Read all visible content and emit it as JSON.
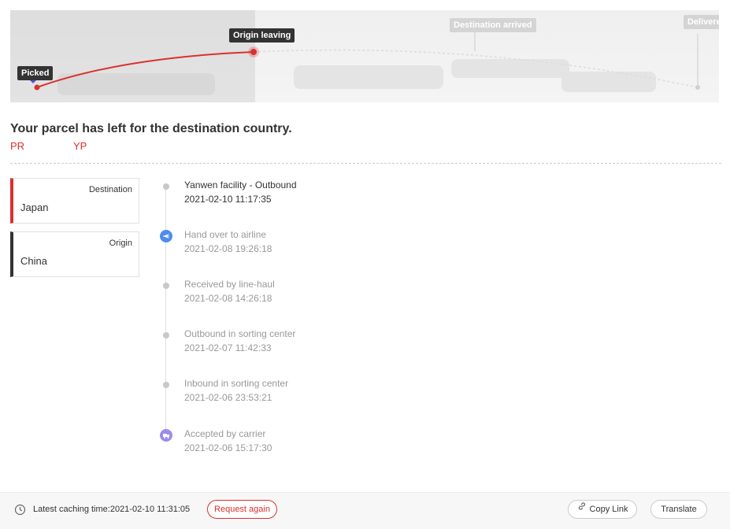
{
  "map": {
    "milestones": [
      {
        "label": "Picked",
        "state": "done"
      },
      {
        "label": "Origin leaving",
        "state": "current"
      },
      {
        "label": "Destination arrived",
        "state": "pending"
      },
      {
        "label": "Delivere",
        "state": "pending"
      }
    ],
    "colors": {
      "route": "#d9312f",
      "done_tag": "#333333",
      "pending_tag": "#d4d4d4"
    }
  },
  "status": {
    "headline": "Your parcel has left for the destination country.",
    "code_left": "PR",
    "code_right": "YP"
  },
  "locations": {
    "destination": {
      "label": "Destination",
      "value": "Japan",
      "accent": "#d9312f"
    },
    "origin": {
      "label": "Origin",
      "value": "China",
      "accent": "#333333"
    }
  },
  "events": [
    {
      "title": "Yanwen facility - Outbound",
      "time": "2021-02-10 11:17:35",
      "icon": "dot"
    },
    {
      "title": "Hand over to airline",
      "time": "2021-02-08 19:26:18",
      "icon": "airplane-icon"
    },
    {
      "title": "Received by line-haul",
      "time": "2021-02-08 14:26:18",
      "icon": "dot"
    },
    {
      "title": "Outbound in sorting center",
      "time": "2021-02-07 11:42:33",
      "icon": "dot"
    },
    {
      "title": "Inbound in sorting center",
      "time": "2021-02-06 23:53:21",
      "icon": "dot"
    },
    {
      "title": "Accepted by carrier",
      "time": "2021-02-06 15:17:30",
      "icon": "truck-icon"
    }
  ],
  "footer": {
    "cache_text": "Latest caching time:2021-02-10 11:31:05",
    "request_again": "Request again",
    "copy_link": "Copy Link",
    "translate": "Translate"
  }
}
